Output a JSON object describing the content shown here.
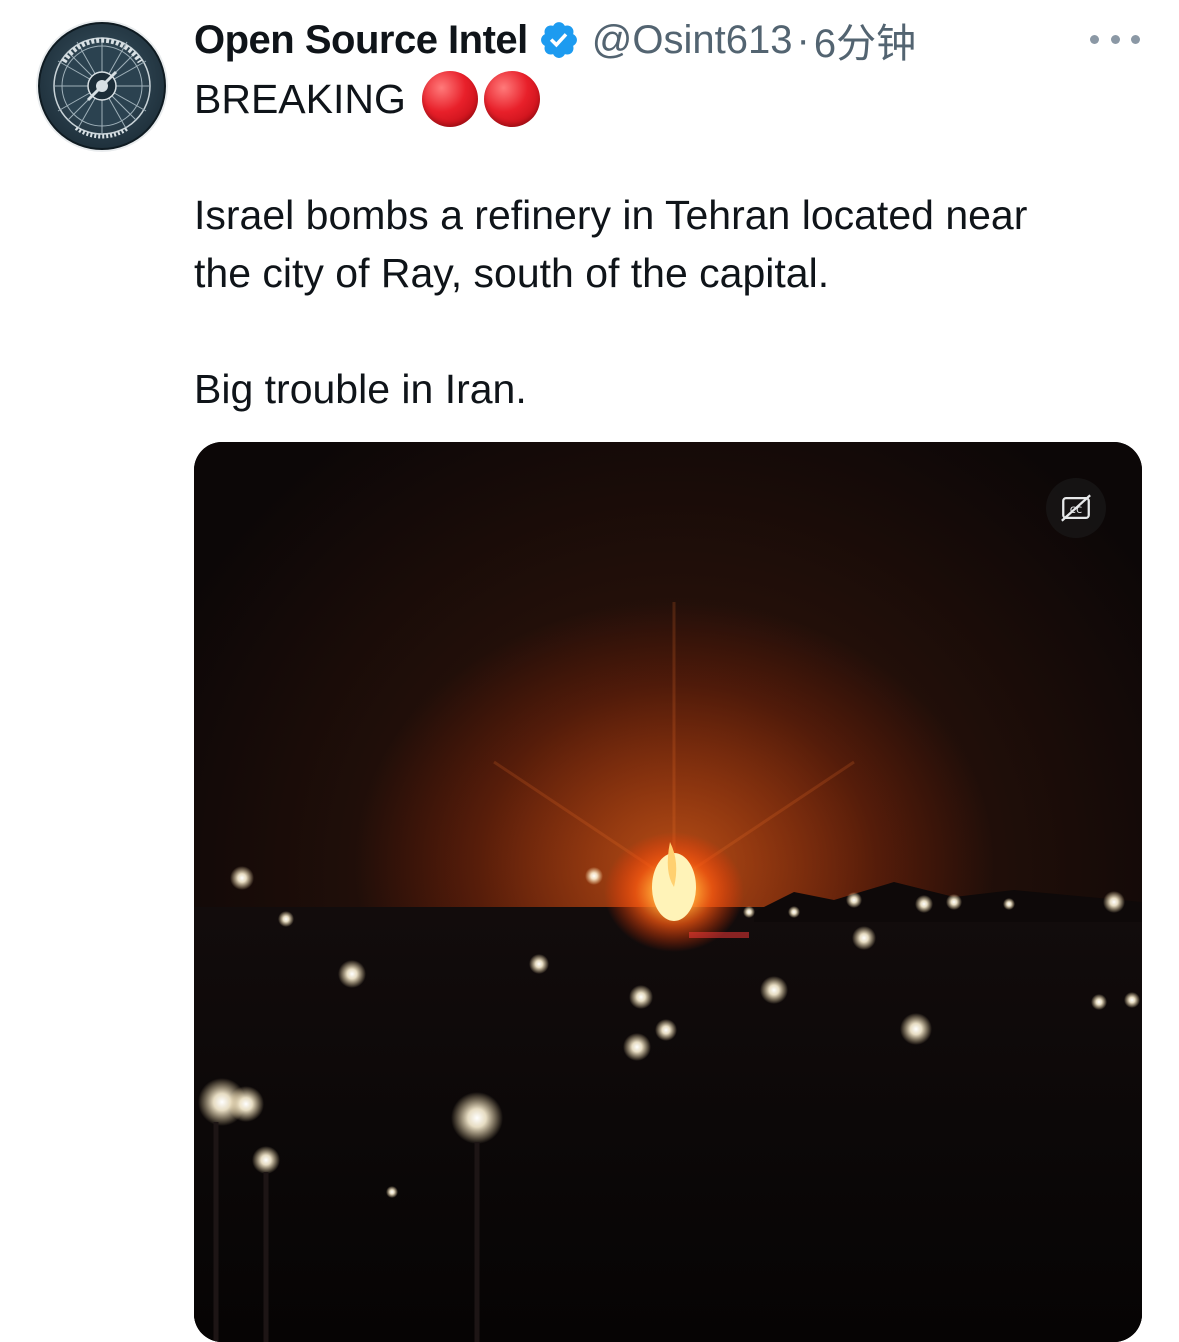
{
  "tweet": {
    "display_name": "Open Source Intel",
    "handle": "@Osint613",
    "separator": "·",
    "time": "6分钟",
    "line1": "BREAKING",
    "line2": "Israel bombs a refinery in Tehran located near",
    "line3": "the city of Ray, south of the capital.",
    "line4": "Big trouble in Iran."
  },
  "icons": {
    "verified": "verified-badge-icon",
    "more": "more-options-icon",
    "captions": "closed-captions-off-icon",
    "emoji": "red-circle-emoji"
  },
  "colors": {
    "verified_blue": "#1d9bf0",
    "secondary_text": "#536471",
    "emoji_red": "#e8202a"
  }
}
